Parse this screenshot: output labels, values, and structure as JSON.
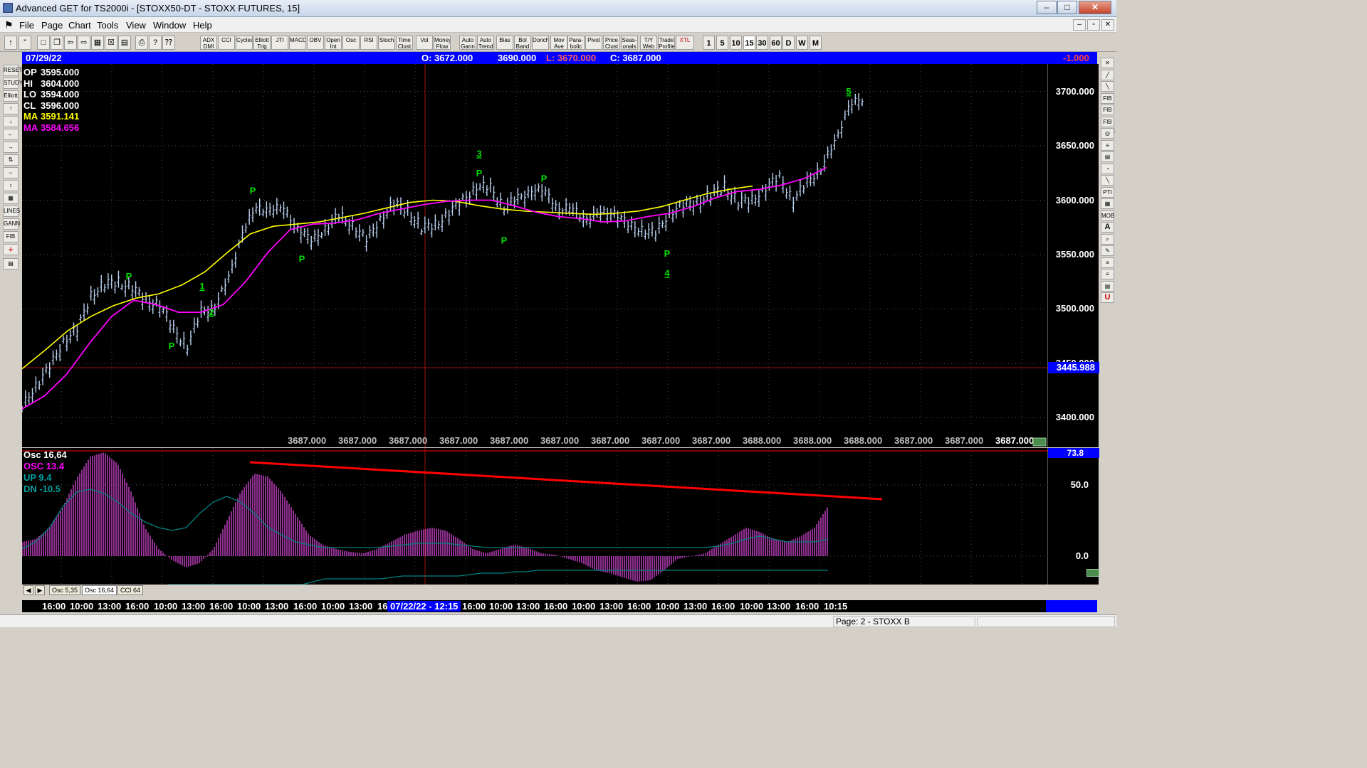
{
  "window": {
    "title": "Advanced GET for TS2000i - [STOXX50-DT - STOXX FUTURES, 15]",
    "min_glyph": "–",
    "max_glyph": "□",
    "close_glyph": "✕",
    "mdi_min": "–",
    "mdi_restore": "▫",
    "mdi_close": "✕"
  },
  "menu": [
    "File",
    "Page",
    "Chart",
    "Tools",
    "View",
    "Window",
    "Help"
  ],
  "toolbar": {
    "studies": [
      "ADX DMI",
      "CCI",
      "Cycles",
      "Elliott Trig",
      "JTI",
      "MACD",
      "OBV",
      "Open Int",
      "Osc",
      "RSI",
      "Stoch",
      "Time Clust",
      "Vol",
      "Money Flow",
      "Auto Gann",
      "Auto Trend",
      "Bias",
      "Bol Band",
      "Donch",
      "Mov Ave",
      "Para-bolic",
      "Pivot",
      "Price Clust",
      "Seas-onals",
      "T/Y Web",
      "Trade Profile",
      "XTL"
    ],
    "periods": [
      "1",
      "5",
      "10",
      "15",
      "30",
      "60",
      "D",
      "W",
      "M"
    ]
  },
  "left_tools": [
    "RESET",
    "STUDY",
    "Elliott",
    "↑",
    "↓",
    "←",
    "→",
    "⇅",
    "⇔",
    "↕",
    "▦",
    "LINES",
    "GANN",
    "FIB",
    "+",
    "▤"
  ],
  "right_tools": [
    "✕",
    "╱",
    "╲",
    "FIB RET",
    "FIB EXT",
    "FIB TIME",
    "◎",
    "≡",
    "▤",
    "◔",
    "╲",
    "PTI",
    "▦",
    "MOB",
    "A",
    "⌕",
    "✎",
    "≡",
    "≡",
    "▤",
    "U"
  ],
  "header": {
    "date": "07/29/22",
    "open": "O: 3672.000",
    "high": "3690.000",
    "low": "L: 3670.000",
    "close": "C: 3687.000",
    "change": "-1.000"
  },
  "info_panel": [
    {
      "label": "OP",
      "value": "3595.000",
      "color": "#ffffff"
    },
    {
      "label": "HI",
      "value": "3604.000",
      "color": "#ffffff"
    },
    {
      "label": "LO",
      "value": "3594.000",
      "color": "#ffffff"
    },
    {
      "label": "CL",
      "value": "3596.000",
      "color": "#ffffff"
    },
    {
      "label": "MA",
      "value": "3591.141",
      "color": "#ffff00"
    },
    {
      "label": "MA",
      "value": "3584.656",
      "color": "#ff00ff"
    }
  ],
  "price_axis": [
    "3700.000",
    "3650.000",
    "3600.000",
    "3550.000",
    "3500.000",
    "3450.000",
    "3400.000"
  ],
  "price_marker": "3445.988",
  "bottom_values": [
    "3687.000",
    "3687.000",
    "3687.000",
    "3687.000",
    "3687.000",
    "3687.000",
    "3687.000",
    "3687.000",
    "3687.000",
    "3688.000",
    "3688.000",
    "3688.000",
    "3687.000",
    "3687.000",
    "3687.000"
  ],
  "wave_labels": [
    {
      "text": "P",
      "x": 150,
      "y": 3527
    },
    {
      "text": "1",
      "x": 253,
      "y": 3518
    },
    {
      "text": "2",
      "x": 266,
      "y": 3494
    },
    {
      "text": "P",
      "x": 210,
      "y": 3463
    },
    {
      "text": "P",
      "x": 324,
      "y": 3606
    },
    {
      "text": "P",
      "x": 393,
      "y": 3543
    },
    {
      "text": "3",
      "x": 642,
      "y": 3640
    },
    {
      "text": "P",
      "x": 642,
      "y": 3622
    },
    {
      "text": "P",
      "x": 733,
      "y": 3617
    },
    {
      "text": "P",
      "x": 677,
      "y": 3560
    },
    {
      "text": "P",
      "x": 906,
      "y": 3548
    },
    {
      "text": "4",
      "x": 906,
      "y": 3530
    },
    {
      "text": "5",
      "x": 1161,
      "y": 3697
    }
  ],
  "osc_info": [
    {
      "label": "Osc 16,64",
      "color": "#ffffff"
    },
    {
      "label": "OSC 13.4",
      "color": "#ff00ff"
    },
    {
      "label": "UP  9.4",
      "color": "#00a0a0"
    },
    {
      "label": "DN  -10.5",
      "color": "#00a0a0"
    }
  ],
  "osc_axis": [
    "73.8",
    "50.0",
    "0.0"
  ],
  "osc_tabs": [
    "Osc 5,35",
    "Osc 16,64",
    "CCI 64"
  ],
  "tab_nav": [
    "◀",
    "▶"
  ],
  "time_axis": [
    "16:00",
    "10:00",
    "13:00",
    "16:00",
    "10:00",
    "13:00",
    "16:00",
    "10:00",
    "13:00",
    "16:00",
    "10:00",
    "13:00",
    "16",
    "07/22/22 - 12:15",
    "16:00",
    "10:00",
    "13:00",
    "16:00",
    "10:00",
    "13:00",
    "16:00",
    "10:00",
    "13:00",
    "16:00",
    "10:00",
    "13:00",
    "16:00",
    "10:15"
  ],
  "status": {
    "page": "Page: 2 - STOXX B"
  },
  "colors": {
    "background": "#000000",
    "price_bars": "#b8d0f0",
    "ma_fast": "#ffff00",
    "ma_slow": "#ff00ff",
    "osc_hist": "#c040c0",
    "band_line": "#008080",
    "trendline": "#ff0000",
    "wave_label": "#00e000",
    "crosshair": "#a01010"
  },
  "chart_data": {
    "type": "line",
    "title": "",
    "x_range": [
      0,
      1440
    ],
    "ylim": [
      3380,
      3720
    ],
    "series": [
      {
        "name": "",
        "values": [
          3408,
          3430,
          3445,
          3470,
          3480,
          3512,
          3522,
          3524,
          3519,
          3507,
          3504,
          3480,
          3466,
          3496,
          3503,
          3526,
          3572,
          3590,
          3594,
          3589,
          3576,
          3560,
          3575,
          3584,
          3578,
          3562,
          3582,
          3596,
          3590,
          3574,
          3576,
          3588,
          3599,
          3612,
          3610,
          3594,
          3600,
          3610,
          3605,
          3593,
          3589,
          3584,
          3586,
          3590,
          3575,
          3574,
          3568,
          3588,
          3594,
          3598,
          3604,
          3612,
          3598,
          3599,
          3611,
          3620,
          3600,
          3615,
          3630,
          3650,
          3688,
          3690
        ]
      },
      {
        "name": "MA",
        "values": [
          3445,
          3462,
          3480,
          3493,
          3503,
          3510,
          3514,
          3522,
          3534,
          3552,
          3569,
          3576,
          3578,
          3580,
          3584,
          3588,
          3593,
          3598,
          3600,
          3599,
          3595,
          3592,
          3590,
          3589,
          3588,
          3587,
          3588,
          3590,
          3594,
          3600,
          3606,
          3610,
          3613
        ]
      },
      {
        "name": "MA",
        "values": [
          3408,
          3420,
          3440,
          3468,
          3493,
          3508,
          3504,
          3497,
          3497,
          3504,
          3525,
          3552,
          3573,
          3578,
          3579,
          3582,
          3588,
          3592,
          3596,
          3599,
          3600,
          3600,
          3595,
          3589,
          3585,
          3583,
          3580,
          3581,
          3585,
          3588,
          3594,
          3602,
          3608,
          3610,
          3614,
          3620,
          3630
        ]
      }
    ],
    "oscillator": {
      "name": "Osc 16,64",
      "ylim": [
        -20,
        75
      ],
      "values": [
        10,
        12,
        20,
        35,
        55,
        70,
        73,
        65,
        45,
        20,
        5,
        -3,
        -8,
        -5,
        5,
        25,
        45,
        58,
        56,
        45,
        30,
        15,
        8,
        5,
        3,
        2,
        5,
        10,
        15,
        18,
        20,
        18,
        12,
        5,
        2,
        5,
        8,
        6,
        2,
        1,
        -2,
        -5,
        -10,
        -12,
        -15,
        -18,
        -17,
        -10,
        -2,
        0,
        2,
        8,
        14,
        20,
        17,
        12,
        10,
        14,
        20,
        35
      ],
      "up": [
        5,
        10,
        20,
        35,
        45,
        47,
        44,
        38,
        30,
        24,
        20,
        18,
        20,
        30,
        38,
        42,
        38,
        30,
        20,
        15,
        10,
        8,
        6,
        6,
        6,
        6,
        6,
        7,
        8,
        9,
        9,
        9,
        8,
        7,
        6,
        6,
        6,
        6,
        6,
        6,
        6,
        6,
        6,
        6,
        6,
        6,
        6,
        6,
        6,
        6,
        6,
        7,
        9,
        12,
        14,
        12,
        10,
        10,
        10,
        12
      ],
      "dn": [
        -20,
        -20,
        -20,
        -20,
        -20,
        -20,
        -20,
        -20,
        -20,
        -20,
        -20,
        -20,
        -20,
        -18,
        -16,
        -16,
        -16,
        -16,
        -16,
        -16,
        -15,
        -14,
        -14,
        -14,
        -14,
        -14,
        -14,
        -13,
        -12,
        -12,
        -12,
        -11,
        -11,
        -10,
        -10,
        -10,
        -10,
        -10,
        -10,
        -10,
        -10,
        -10,
        -10,
        -10,
        -10,
        -10,
        -10,
        -10,
        -10,
        -10,
        -10,
        -10,
        -10,
        -10,
        -10,
        -10,
        -10,
        -10,
        -10,
        -10
      ],
      "trendline": [
        [
          320,
          66
        ],
        [
          1208,
          40
        ]
      ],
      "axis_ticks": [
        50,
        0
      ]
    }
  }
}
